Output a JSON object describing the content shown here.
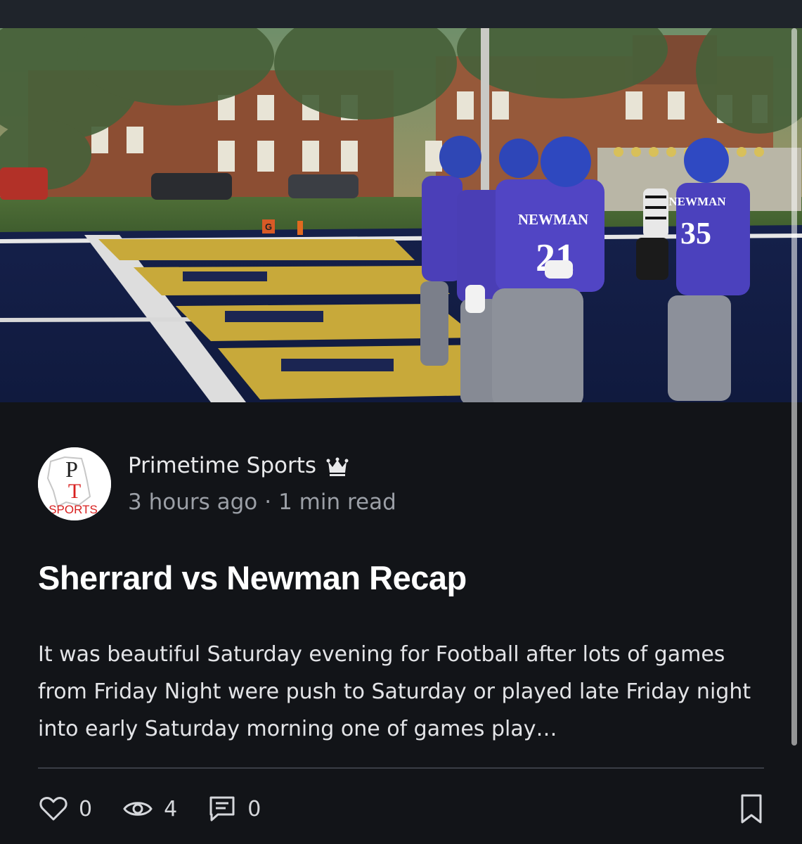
{
  "post": {
    "author": "Primetime Sports",
    "author_badge_icon": "crown-icon",
    "published": "3 hours ago",
    "separator": "·",
    "read_time": "1 min read",
    "title": "Sherrard vs Newman Recap",
    "excerpt": "It was beautiful Saturday evening for Football after lots of games from Friday Night were push to Saturday or played late Friday night into early Saturday morning one of games play…",
    "cover_image_jersey_texts": [
      "NEWMAN",
      "21",
      "NEWMAN",
      "35"
    ],
    "field_marker": "G"
  },
  "avatar": {
    "letters_top": "P",
    "letters_bottom": "T",
    "word": "SPORTS"
  },
  "stats": {
    "likes": "0",
    "views": "4",
    "comments": "0"
  },
  "colors": {
    "background": "#121418",
    "top_strip": "#1f242b",
    "text_primary": "#ffffff",
    "text_secondary": "#9b9fa6",
    "divider": "#3a3e45",
    "avatar_red": "#d8201f",
    "jersey_blue": "#4b3fb8"
  }
}
